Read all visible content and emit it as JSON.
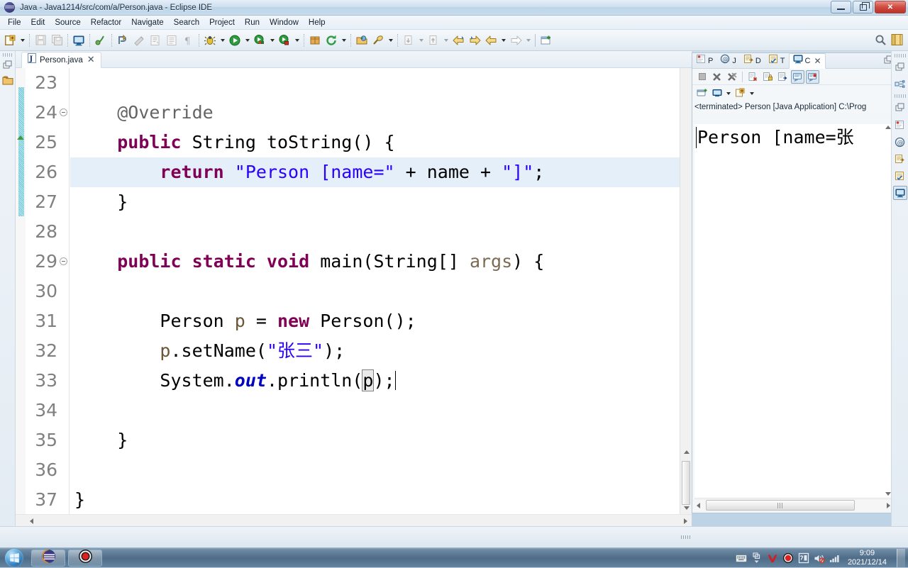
{
  "window": {
    "title": "Java - Java1214/src/com/a/Person.java - Eclipse IDE",
    "logo_icon": "eclipse-logo-icon",
    "minimize_label": "–",
    "maximize_label": "❐",
    "close_label": "✕"
  },
  "menubar": {
    "items": [
      {
        "label": "File"
      },
      {
        "label": "Edit"
      },
      {
        "label": "Source"
      },
      {
        "label": "Refactor"
      },
      {
        "label": "Navigate"
      },
      {
        "label": "Search"
      },
      {
        "label": "Project"
      },
      {
        "label": "Run"
      },
      {
        "label": "Window"
      },
      {
        "label": "Help"
      }
    ]
  },
  "toolbar": {
    "items": [
      {
        "icon": "new-wizard-icon",
        "dropdown": true
      },
      {
        "sep": true
      },
      {
        "icon": "save-icon",
        "disabled": true
      },
      {
        "icon": "save-all-icon",
        "disabled": true
      },
      {
        "sep": true
      },
      {
        "icon": "new-java-console-icon"
      },
      {
        "sep": true
      },
      {
        "icon": "skip-breakpoints-icon"
      },
      {
        "sep": true
      },
      {
        "icon": "toggle-mark-occurrences-icon"
      },
      {
        "icon": "build-all-icon",
        "disabled": true
      },
      {
        "icon": "open-task-icon",
        "disabled": true
      },
      {
        "icon": "open-type-icon",
        "disabled": true
      },
      {
        "icon": "pilcrow-icon",
        "disabled": true
      },
      {
        "sep": true
      },
      {
        "icon": "debug-icon",
        "dropdown": true
      },
      {
        "icon": "run-icon",
        "dropdown": true
      },
      {
        "icon": "coverage-icon",
        "dropdown": true
      },
      {
        "icon": "run-external-icon",
        "dropdown": true
      },
      {
        "sep": true
      },
      {
        "icon": "new-package-icon"
      },
      {
        "icon": "refresh-icon",
        "dropdown": true
      },
      {
        "sep": true
      },
      {
        "icon": "open-resource-icon"
      },
      {
        "icon": "search-icon",
        "dropdown": true
      },
      {
        "sep": true
      },
      {
        "icon": "next-annotation-icon",
        "dropdown": true,
        "disabled": true
      },
      {
        "icon": "prev-annotation-icon",
        "dropdown": true,
        "disabled": true
      },
      {
        "icon": "back-icon"
      },
      {
        "icon": "forward-icon"
      },
      {
        "icon": "prev-edit-icon",
        "dropdown": true
      },
      {
        "icon": "next-edit-icon",
        "dropdown": true,
        "disabled": true
      },
      {
        "sep_solid": true
      },
      {
        "icon": "new-window-icon"
      }
    ],
    "right_items": [
      {
        "icon": "quick-access-search-icon"
      },
      {
        "icon": "open-perspective-icon"
      }
    ]
  },
  "editor": {
    "tab": {
      "label": "Person.java",
      "icon": "java-file-icon",
      "close_label": "✕"
    },
    "left_trim": {
      "restore_icon": "restore-view-icon",
      "package_explorer_icon": "package-explorer-icon"
    },
    "first_visible_line": 23,
    "highlighted_line": 26,
    "lines": [
      {
        "num": "23",
        "fold": false,
        "tokens": []
      },
      {
        "num": "24",
        "fold": true,
        "tokens": [
          {
            "t": "    ",
            "c": ""
          },
          {
            "t": "@Override",
            "c": "ann"
          }
        ]
      },
      {
        "num": "25",
        "fold": false,
        "tokens": [
          {
            "t": "    ",
            "c": ""
          },
          {
            "t": "public",
            "c": "kw"
          },
          {
            "t": " String toString() {",
            "c": ""
          }
        ]
      },
      {
        "num": "26",
        "fold": false,
        "tokens": [
          {
            "t": "        ",
            "c": ""
          },
          {
            "t": "return",
            "c": "kw"
          },
          {
            "t": " ",
            "c": ""
          },
          {
            "t": "\"Person [name=\"",
            "c": "str"
          },
          {
            "t": " + name + ",
            "c": ""
          },
          {
            "t": "\"]\"",
            "c": "str"
          },
          {
            "t": ";",
            "c": ""
          }
        ]
      },
      {
        "num": "27",
        "fold": false,
        "tokens": [
          {
            "t": "    }",
            "c": ""
          }
        ]
      },
      {
        "num": "28",
        "fold": false,
        "tokens": []
      },
      {
        "num": "29",
        "fold": true,
        "tokens": [
          {
            "t": "    ",
            "c": ""
          },
          {
            "t": "public static void",
            "c": "kw"
          },
          {
            "t": " main(String[] ",
            "c": ""
          },
          {
            "t": "args",
            "c": "prm"
          },
          {
            "t": ") {",
            "c": ""
          }
        ]
      },
      {
        "num": "30",
        "fold": false,
        "tokens": []
      },
      {
        "num": "31",
        "fold": false,
        "tokens": [
          {
            "t": "        Person ",
            "c": ""
          },
          {
            "t": "p",
            "c": "lvar"
          },
          {
            "t": " = ",
            "c": ""
          },
          {
            "t": "new",
            "c": "kw"
          },
          {
            "t": " Person();",
            "c": ""
          }
        ]
      },
      {
        "num": "32",
        "fold": false,
        "tokens": [
          {
            "t": "        ",
            "c": ""
          },
          {
            "t": "p",
            "c": "lvar"
          },
          {
            "t": ".setName(",
            "c": ""
          },
          {
            "t": "\"张三\"",
            "c": "str"
          },
          {
            "t": ");",
            "c": ""
          }
        ]
      },
      {
        "num": "33",
        "fold": false,
        "tokens": [
          {
            "t": "        System.",
            "c": ""
          },
          {
            "t": "out",
            "c": "sfield"
          },
          {
            "t": ".println(",
            "c": ""
          },
          {
            "t": "p",
            "c": "occ"
          },
          {
            "t": ");",
            "c": ""
          }
        ],
        "caret": true
      },
      {
        "num": "34",
        "fold": false,
        "tokens": []
      },
      {
        "num": "35",
        "fold": false,
        "tokens": [
          {
            "t": "    }",
            "c": ""
          }
        ]
      },
      {
        "num": "36",
        "fold": false,
        "tokens": []
      },
      {
        "num": "37",
        "fold": false,
        "tokens": [
          {
            "t": "}",
            "c": ""
          }
        ]
      }
    ]
  },
  "console": {
    "tabs": [
      {
        "label": "P",
        "icon": "problems-icon",
        "active": false
      },
      {
        "label": "J",
        "icon": "javadoc-icon",
        "active": false
      },
      {
        "label": "D",
        "icon": "declaration-icon",
        "active": false
      },
      {
        "label": "T",
        "icon": "tasks-icon",
        "active": false
      },
      {
        "label": "C",
        "icon": "console-icon",
        "active": true
      }
    ],
    "tab_close_label": "✕",
    "maximize_icon": "restore-view-icon",
    "toolbar_row1": [
      {
        "icon": "terminate-icon",
        "disabled": true
      },
      {
        "icon": "remove-launch-icon"
      },
      {
        "icon": "remove-all-launches-icon"
      },
      {
        "sep": true
      },
      {
        "icon": "clear-console-icon"
      },
      {
        "icon": "scroll-lock-icon"
      },
      {
        "icon": "word-wrap-icon"
      },
      {
        "icon": "pin-console-icon",
        "pressed": true
      },
      {
        "icon": "display-selected-console-icon",
        "pressed": true
      }
    ],
    "toolbar_row2": [
      {
        "icon": "new-console-view-icon"
      },
      {
        "icon": "open-console-icon",
        "dropdown": true
      },
      {
        "icon": "console-options-icon",
        "dropdown": true
      }
    ],
    "header": "<terminated> Person [Java Application] C:\\Prog",
    "output": "Person [name=张",
    "hscroll_left_label": "◀",
    "hscroll_right_label": "▶"
  },
  "right_trim": {
    "items": [
      {
        "icon": "restore-view-icon"
      },
      {
        "icon": "outline-icon"
      },
      {
        "icon": "restore-view-icon"
      },
      {
        "icon": "problems-icon"
      },
      {
        "icon": "javadoc-icon"
      },
      {
        "icon": "declaration-icon"
      },
      {
        "icon": "tasks-icon"
      },
      {
        "icon": "console-icon",
        "selected": true
      }
    ]
  },
  "taskbar": {
    "start_icon": "windows-start-orb-icon",
    "tasks": [
      {
        "icon": "eclipse-taskbar-icon"
      },
      {
        "icon": "screen-recorder-icon"
      }
    ],
    "tray": [
      {
        "icon": "keyboard-icon"
      },
      {
        "icon": "show-hidden-icons-icon"
      },
      {
        "icon": "sogou-input-icon"
      },
      {
        "icon": "recording-indicator-icon"
      },
      {
        "icon": "input-method-icon"
      },
      {
        "icon": "volume-muted-icon"
      },
      {
        "icon": "network-icon"
      }
    ],
    "clock_time": "9:09",
    "clock_date": "2021/12/14"
  },
  "colors": {
    "keyword": "#7f0055",
    "string": "#2a00ff",
    "annotation": "#646464",
    "static_field": "#0000c0",
    "parameter": "#7c6b52",
    "line_number": "#808080",
    "highlight_line": "#e4eff9",
    "change_bar": "#6fc8d8",
    "taskbar": "#4e6c88"
  }
}
